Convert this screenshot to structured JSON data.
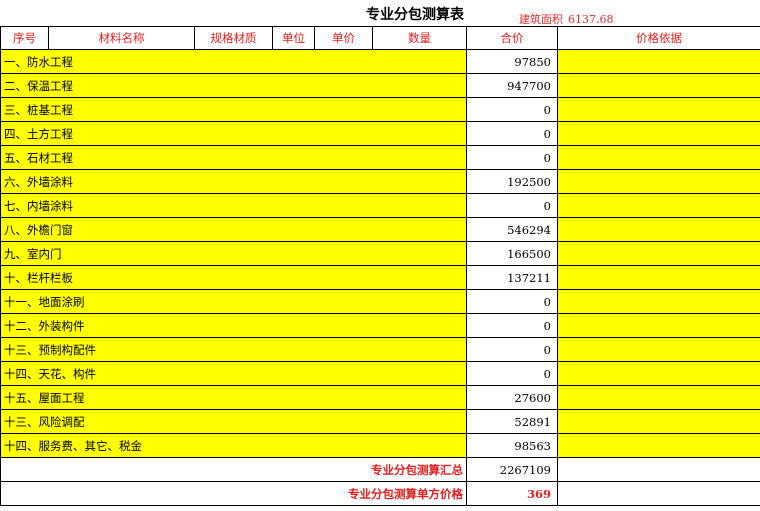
{
  "title": "专业分包测算表",
  "building_area": {
    "label": "建筑面积",
    "value": "6137.68"
  },
  "headers": [
    "序号",
    "材料名称",
    "规格材质",
    "单位",
    "单价",
    "数量",
    "合价",
    "价格依据"
  ],
  "items": [
    {
      "name": "一、防水工程",
      "amount": "97850"
    },
    {
      "name": "二、保温工程",
      "amount": "947700"
    },
    {
      "name": "三、桩基工程",
      "amount": "0"
    },
    {
      "name": "四、土方工程",
      "amount": "0"
    },
    {
      "name": "五、石材工程",
      "amount": "0"
    },
    {
      "name": "六、外墙涂料",
      "amount": "192500"
    },
    {
      "name": "七、内墙涂料",
      "amount": "0"
    },
    {
      "name": "八、外檐门窗",
      "amount": "546294"
    },
    {
      "name": "九、室内门",
      "amount": "166500"
    },
    {
      "name": "十、栏杆栏板",
      "amount": "137211"
    },
    {
      "name": "十一、地面涂刷",
      "amount": "0"
    },
    {
      "name": "十二、外装构件",
      "amount": "0"
    },
    {
      "name": "十三、预制构配件",
      "amount": "0"
    },
    {
      "name": "十四、天花、构件",
      "amount": "0"
    },
    {
      "name": "十五、屋面工程",
      "amount": "27600"
    },
    {
      "name": "十三、风险调配",
      "amount": "52891"
    },
    {
      "name": "十四、服务费、其它、税金",
      "amount": "98563"
    }
  ],
  "summary": {
    "total_label": "专业分包测算汇总",
    "total_value": "2267109",
    "unit_price_label": "专业分包测算单方价格",
    "unit_price_value": "369"
  }
}
